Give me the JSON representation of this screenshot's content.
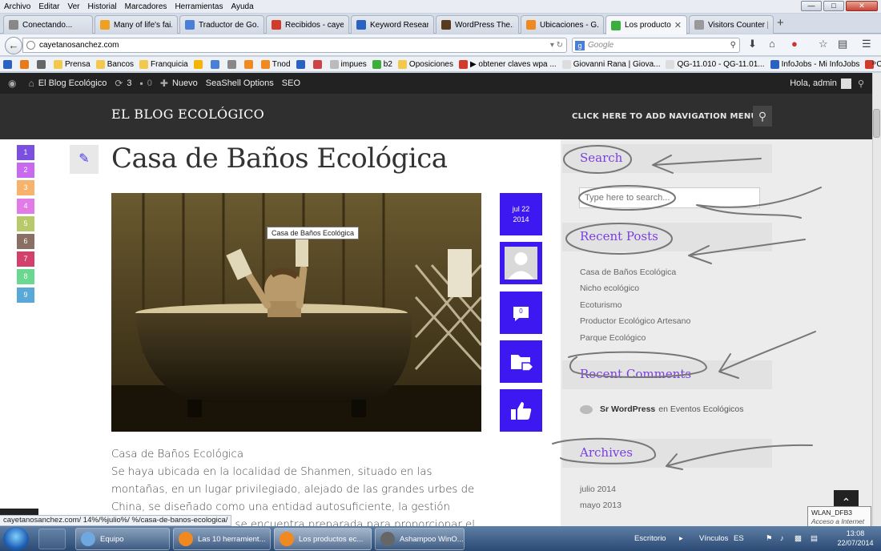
{
  "menubar": {
    "items": [
      "Archivo",
      "Editar",
      "Ver",
      "Historial",
      "Marcadores",
      "Herramientas",
      "Ayuda"
    ]
  },
  "tabs": [
    {
      "label": "Conectando...",
      "color": "#888888",
      "active": false
    },
    {
      "label": "Many of life's fai...",
      "color": "#f0a020",
      "active": false
    },
    {
      "label": "Traductor de Go...",
      "color": "#4a7fd8",
      "active": false
    },
    {
      "label": "Recibidos - caye...",
      "color": "#d23a2a",
      "active": false
    },
    {
      "label": "Keyword Researc...",
      "color": "#2a62c4",
      "active": false
    },
    {
      "label": "WordPress The...",
      "color": "#5a3a1e",
      "active": false
    },
    {
      "label": "Ubicaciones - G...",
      "color": "#f08a20",
      "active": false
    },
    {
      "label": "Los producto...",
      "color": "#3cae3c",
      "active": true
    },
    {
      "label": "Visitors Counter | Visi...",
      "color": "#999999",
      "active": false
    }
  ],
  "new_tab_label": "+",
  "nav": {
    "url": "cayetanosanchez.com",
    "search_placeholder": "Google"
  },
  "bookmarks": [
    {
      "label": "",
      "color": "#2a62c4"
    },
    {
      "label": "",
      "color": "#e87a1a"
    },
    {
      "label": "",
      "color": "#666666"
    },
    {
      "label": "Prensa",
      "color": "#f2c94c"
    },
    {
      "label": "Bancos",
      "color": "#f2c94c"
    },
    {
      "label": "Franquicia",
      "color": "#f2c94c"
    },
    {
      "label": "",
      "color": "#f5b400"
    },
    {
      "label": "",
      "color": "#4a7fd8"
    },
    {
      "label": "",
      "color": "#888888"
    },
    {
      "label": "",
      "color": "#f08a20"
    },
    {
      "label": "Tnod",
      "color": "#f08a20"
    },
    {
      "label": "",
      "color": "#2a62c4"
    },
    {
      "label": "",
      "color": "#c44"
    },
    {
      "label": "impues",
      "color": "#bbbbbb"
    },
    {
      "label": "b2",
      "color": "#3cae3c"
    },
    {
      "label": "Oposiciones",
      "color": "#f2c94c"
    },
    {
      "label": "▶ obtener claves wpa ...",
      "color": "#d23a2a"
    },
    {
      "label": "Giovanni Rana | Giova...",
      "color": "#dddddd"
    },
    {
      "label": "QG-11.010 - QG-11.01...",
      "color": "#dddddd"
    },
    {
      "label": "InfoJobs - Mi InfoJobs",
      "color": "#2a62c4"
    },
    {
      "label": "Candidaturas espontá...",
      "color": "#d23a2a"
    }
  ],
  "bookmarks_more": "»",
  "wpbar": {
    "site": "El Blog Ecológico",
    "updates": "3",
    "comments": "0",
    "new": "Nuevo",
    "seashell": "SeaShell Options",
    "seo": "SEO",
    "greeting": "Hola, admin"
  },
  "site": {
    "title": "EL BLOG ECOLÓGICO",
    "nav_hint": "CLICK HERE TO ADD NAVIGATION MENU"
  },
  "number_tabs": [
    {
      "n": "1",
      "color": "#7b4fe0"
    },
    {
      "n": "2",
      "color": "#c86af0"
    },
    {
      "n": "3",
      "color": "#f7b36b"
    },
    {
      "n": "4",
      "color": "#e27ae8"
    },
    {
      "n": "5",
      "color": "#b8c96a"
    },
    {
      "n": "6",
      "color": "#8a7062"
    },
    {
      "n": "7",
      "color": "#d2416c"
    },
    {
      "n": "8",
      "color": "#6ad890"
    },
    {
      "n": "9",
      "color": "#58a8d8"
    }
  ],
  "post": {
    "title": "Casa de Baños Ecológica",
    "image_tooltip": "Casa de Baños Ecológica",
    "date_month_day": "jul 22",
    "date_year": "2014",
    "comment_count": "0",
    "subtitle": "Casa de Baños Ecológica",
    "body": "Se haya ubicada en la localidad de Shanmen, situado en las montañas, en un lugar privilegiado, alejado de las grandes urbes de China, se diseñado como una entidad autosuficiente, la gestión ecológica de las aguas se encuentra preparada para proporcionar el agua que precisan"
  },
  "sidebar": {
    "search_title": "Search",
    "search_placeholder": "Type here to search...",
    "recent_posts_title": "Recent Posts",
    "recent_posts": [
      "Casa de Baños Ecológica",
      "Nicho ecológico",
      "Ecoturismo",
      "Productor Ecológico Artesano",
      "Parque Ecológico"
    ],
    "recent_comments_title": "Recent Comments",
    "comment_author": "Sr WordPress",
    "comment_on": "en",
    "comment_post": "Eventos Ecológicos",
    "archives_title": "Archives",
    "archives": [
      "julio 2014",
      "mayo 2013"
    ]
  },
  "status_url": "cayetanosanchez.com/ 14%/%julio%/ %/casa-de-banos-ecologica/",
  "wlan": {
    "name": "WLAN_DFB3",
    "status": "Acceso a Internet"
  },
  "taskbar": {
    "tasks": [
      {
        "label": "Equipo",
        "color": "#6fa8e0",
        "active": false
      },
      {
        "label": "Las 10 herramient...",
        "color": "#f08a20",
        "active": false
      },
      {
        "label": "Los productos ec...",
        "color": "#f08a20",
        "active": true
      },
      {
        "label": "Ashampoo WinO...",
        "color": "#666666",
        "active": false
      }
    ],
    "desktop": "Escritorio",
    "links": "Vínculos",
    "lang": "ES",
    "time": "13:08",
    "date": "22/07/2014"
  },
  "colors": {
    "accent": "#3d18f0",
    "widget_title": "#7a3fe0",
    "header_bg": "#2f2f2f",
    "admin_bar": "#222222"
  }
}
